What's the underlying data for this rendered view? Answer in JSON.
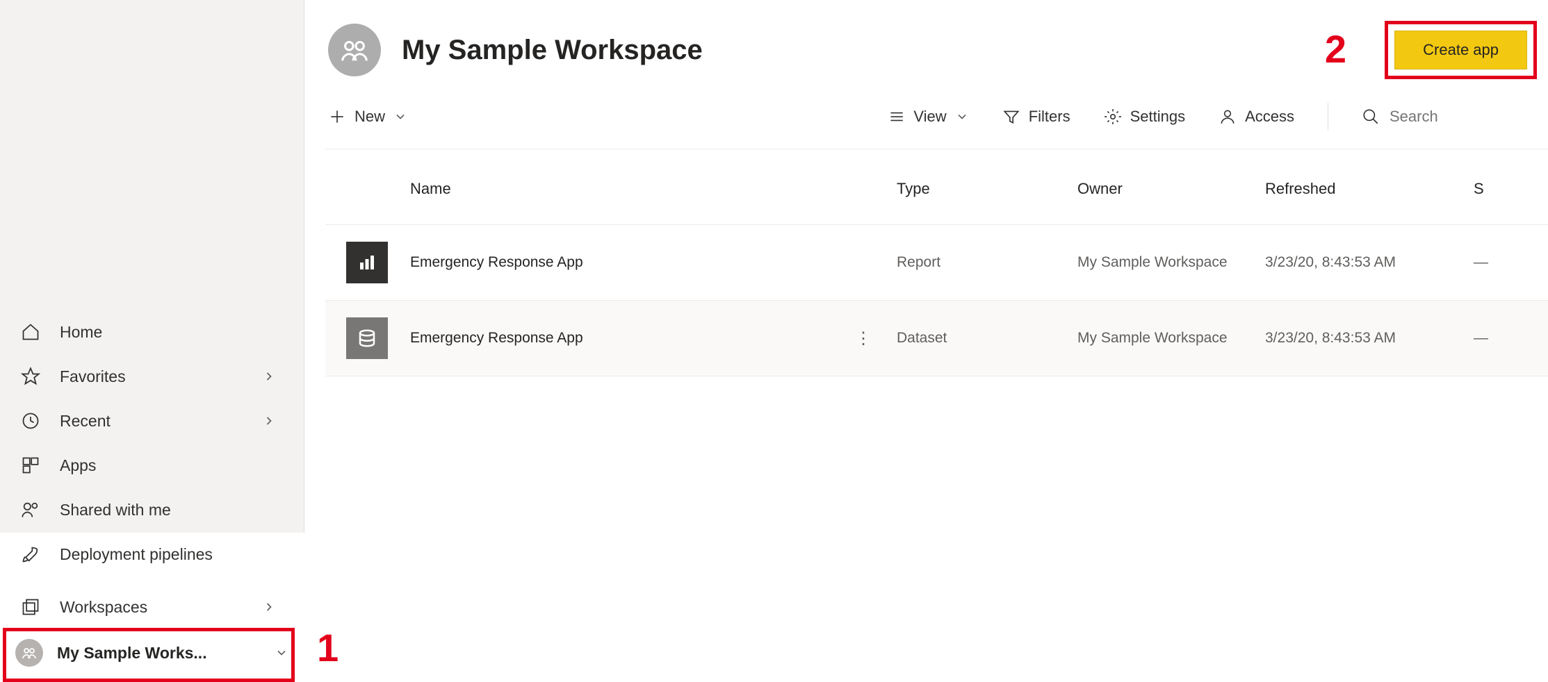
{
  "sidebar": {
    "items": [
      {
        "label": "Home"
      },
      {
        "label": "Favorites"
      },
      {
        "label": "Recent"
      },
      {
        "label": "Apps"
      },
      {
        "label": "Shared with me"
      },
      {
        "label": "Deployment pipelines"
      }
    ],
    "workspaces_label": "Workspaces",
    "current_workspace": "My Sample Works..."
  },
  "header": {
    "title": "My Sample Workspace",
    "create_app_label": "Create app"
  },
  "toolbar": {
    "new_label": "New",
    "view_label": "View",
    "filters_label": "Filters",
    "settings_label": "Settings",
    "access_label": "Access",
    "search_placeholder": "Search"
  },
  "table": {
    "columns": {
      "name": "Name",
      "type": "Type",
      "owner": "Owner",
      "refreshed": "Refreshed",
      "s": "S"
    },
    "rows": [
      {
        "icon": "report",
        "name": "Emergency Response App",
        "type": "Report",
        "owner": "My Sample Workspace",
        "refreshed": "3/23/20, 8:43:53 AM",
        "s": "—"
      },
      {
        "icon": "dataset",
        "name": "Emergency Response App",
        "type": "Dataset",
        "owner": "My Sample Workspace",
        "refreshed": "3/23/20, 8:43:53 AM",
        "s": "—"
      }
    ]
  },
  "annotations": {
    "one": "1",
    "two": "2"
  }
}
